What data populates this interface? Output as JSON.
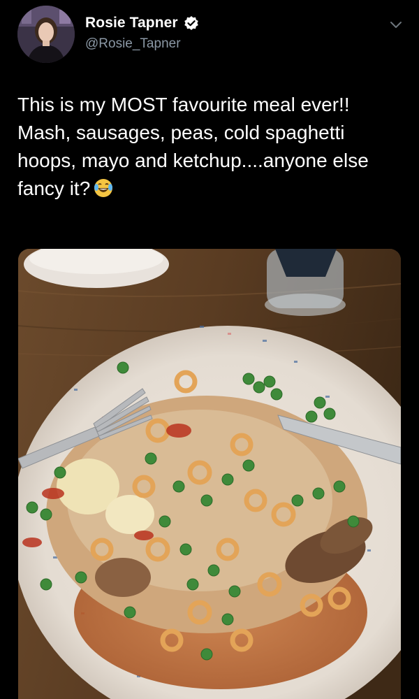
{
  "tweet": {
    "display_name": "Rosie Tapner",
    "handle": "@Rosie_Tapner",
    "verified": true,
    "text": "This is my MOST favourite meal ever!! Mash, sausages, peas, cold spaghetti hoops, mayo and ketchup....anyone else fancy it?",
    "emoji": "face-with-tears-of-joy"
  },
  "icons": {
    "verified": "verified-badge-icon",
    "more": "chevron-down-icon",
    "emoji": "tears-of-joy-emoji-icon"
  },
  "colors": {
    "background": "#000000",
    "text": "#ffffff",
    "secondary_text": "#8b98a5",
    "verified_badge": "#ffffff"
  },
  "media": {
    "type": "photo",
    "subject": "plate of mash, sausages, peas, spaghetti hoops, mayo and ketchup with fork and knife"
  }
}
